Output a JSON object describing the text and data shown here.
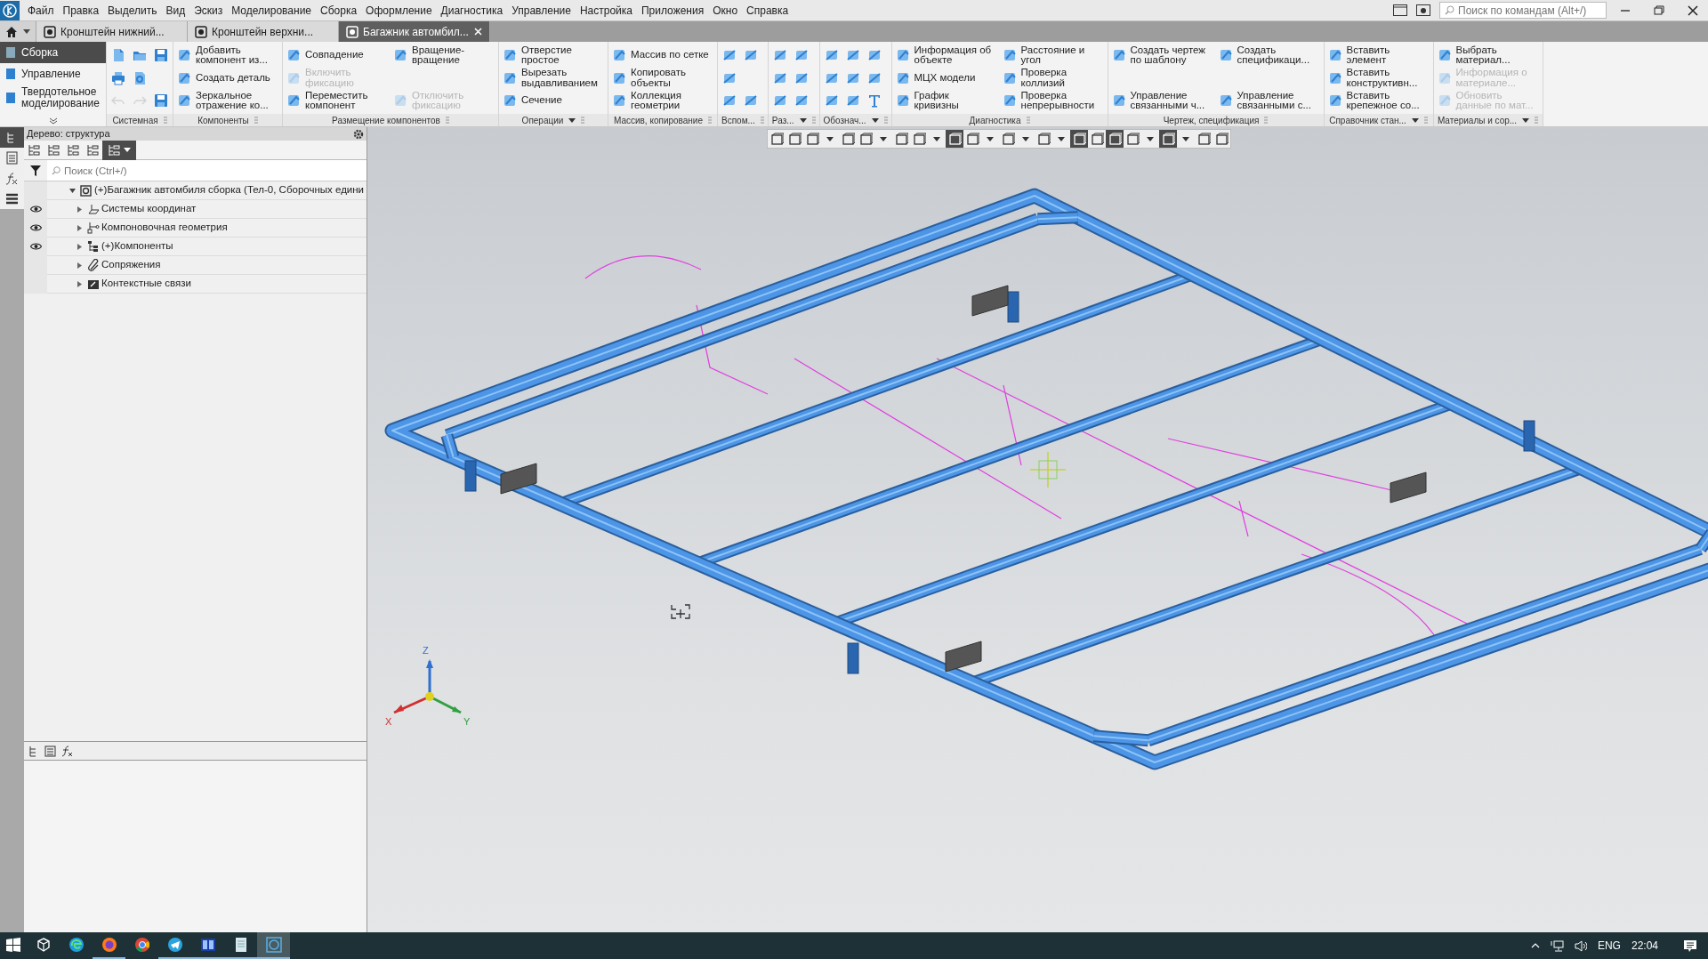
{
  "menu": {
    "items": [
      "Файл",
      "Правка",
      "Выделить",
      "Вид",
      "Эскиз",
      "Моделирование",
      "Сборка",
      "Оформление",
      "Диагностика",
      "Управление",
      "Настройка",
      "Приложения",
      "Окно",
      "Справка"
    ]
  },
  "command_search": {
    "placeholder": "Поиск по командам (Alt+/)"
  },
  "document_tabs": [
    {
      "label": "Кронштейн нижний...",
      "selected": false
    },
    {
      "label": "Кронштейн верхни...",
      "selected": false
    },
    {
      "label": "Багажник автомбил...",
      "selected": true
    }
  ],
  "ribbon": {
    "modes": [
      {
        "label": "Сборка",
        "selected": true
      },
      {
        "label": "Управление",
        "selected": false
      },
      {
        "label": "Твердотельное моделирование",
        "selected": false
      }
    ],
    "groups": [
      {
        "title": "Системная",
        "dropdown": false,
        "columns": [
          [
            {
              "kind": "document",
              "disabled": false
            },
            {
              "kind": "printer",
              "disabled": false
            },
            {
              "kind": "undo",
              "disabled": true
            }
          ],
          [
            {
              "kind": "folder",
              "disabled": false
            },
            {
              "kind": "preview",
              "disabled": false
            },
            {
              "kind": "redo",
              "disabled": true
            }
          ],
          [
            {
              "kind": "disk",
              "disabled": false
            },
            {
              "kind": "disk",
              "disabled": false
            }
          ]
        ]
      },
      {
        "title": "Компоненты",
        "dropdown": false,
        "columns": [
          [
            {
              "kind": "labeled",
              "label": "Добавить компонент из...",
              "disabled": false
            },
            {
              "kind": "labeled",
              "label": "Создать деталь",
              "disabled": false
            },
            {
              "kind": "labeled",
              "label": "Зеркальное отражение ко...",
              "disabled": false
            }
          ]
        ]
      },
      {
        "title": "Размещение компонентов",
        "dropdown": false,
        "columns": [
          [
            {
              "kind": "labeled",
              "label": "Совпадение",
              "disabled": false
            },
            {
              "kind": "labeled",
              "label": "Включить фиксацию",
              "disabled": true
            },
            {
              "kind": "labeled",
              "label": "Переместить компонент",
              "disabled": false
            }
          ],
          [
            {
              "kind": "labeled",
              "label": "Вращение-вращение",
              "disabled": false
            },
            {
              "kind": "labeled",
              "label": "Отключить фиксацию",
              "disabled": true
            }
          ]
        ]
      },
      {
        "title": "Операции",
        "dropdown": true,
        "columns": [
          [
            {
              "kind": "labeled",
              "label": "Отверстие простое",
              "disabled": false
            },
            {
              "kind": "labeled",
              "label": "Вырезать выдавливанием",
              "disabled": false
            },
            {
              "kind": "labeled",
              "label": "Сечение",
              "disabled": false
            }
          ]
        ]
      },
      {
        "title": "Массив, копирование",
        "dropdown": false,
        "columns": [
          [
            {
              "kind": "labeled",
              "label": "Массив по сетке",
              "disabled": false
            },
            {
              "kind": "labeled",
              "label": "Копировать объекты",
              "disabled": false
            },
            {
              "kind": "labeled",
              "label": "Коллекция геометрии",
              "disabled": false
            }
          ]
        ]
      },
      {
        "title": "Вспом...",
        "dropdown": false,
        "columns": [
          [
            {
              "kind": "tool",
              "disabled": false
            },
            {
              "kind": "tool",
              "disabled": false
            },
            {
              "kind": "tool",
              "disabled": false
            }
          ],
          [
            {
              "kind": "tool",
              "disabled": false
            },
            {
              "kind": "tool",
              "disabled": false
            }
          ]
        ]
      },
      {
        "title": "Раз...",
        "dropdown": true,
        "columns": [
          [
            {
              "kind": "tool",
              "disabled": false
            },
            {
              "kind": "tool",
              "disabled": false
            },
            {
              "kind": "tool",
              "disabled": false
            }
          ],
          [
            {
              "kind": "tool",
              "disabled": false
            },
            {
              "kind": "tool",
              "disabled": false
            },
            {
              "kind": "tool",
              "disabled": false
            }
          ]
        ]
      },
      {
        "title": "Обознач...",
        "dropdown": true,
        "columns": [
          [
            {
              "kind": "tool",
              "disabled": false
            },
            {
              "kind": "tool",
              "disabled": false
            },
            {
              "kind": "tool",
              "disabled": false
            }
          ],
          [
            {
              "kind": "tool",
              "disabled": false
            },
            {
              "kind": "tool",
              "disabled": false
            },
            {
              "kind": "tool",
              "disabled": false
            }
          ],
          [
            {
              "kind": "tool",
              "disabled": false
            },
            {
              "kind": "tool",
              "disabled": false
            },
            {
              "kind": "text",
              "disabled": false
            }
          ]
        ]
      },
      {
        "title": "Диагностика",
        "dropdown": false,
        "columns": [
          [
            {
              "kind": "labeled",
              "label": "Информация об объекте",
              "disabled": false
            },
            {
              "kind": "labeled",
              "label": "МЦХ модели",
              "disabled": false
            },
            {
              "kind": "labeled",
              "label": "График кривизны",
              "disabled": false
            }
          ],
          [
            {
              "kind": "labeled",
              "label": "Расстояние и угол",
              "disabled": false
            },
            {
              "kind": "labeled",
              "label": "Проверка коллизий",
              "disabled": false
            },
            {
              "kind": "labeled",
              "label": "Проверка непрерывности",
              "disabled": false
            }
          ]
        ]
      },
      {
        "title": "Чертеж, спецификация",
        "dropdown": false,
        "columns": [
          [
            {
              "kind": "labeled",
              "label": "Создать чертеж по шаблону",
              "disabled": false
            },
            {
              "kind": "labeled",
              "label": "Управление связанными ч...",
              "disabled": false
            }
          ],
          [
            {
              "kind": "labeled",
              "label": "Создать спецификаци...",
              "disabled": false
            },
            {
              "kind": "labeled",
              "label": "Управление связанными с...",
              "disabled": false
            }
          ]
        ]
      },
      {
        "title": "Справочник стан...",
        "dropdown": true,
        "columns": [
          [
            {
              "kind": "labeled",
              "label": "Вставить элемент",
              "disabled": false
            },
            {
              "kind": "labeled",
              "label": "Вставить конструктивн...",
              "disabled": false
            },
            {
              "kind": "labeled",
              "label": "Вставить крепежное со...",
              "disabled": false
            }
          ]
        ]
      },
      {
        "title": "Материалы и сор...",
        "dropdown": true,
        "columns": [
          [
            {
              "kind": "labeled",
              "label": "Выбрать материал...",
              "disabled": false
            },
            {
              "kind": "labeled",
              "label": "Информация о материале...",
              "disabled": true
            },
            {
              "kind": "labeled",
              "label": "Обновить данные по мат...",
              "disabled": true
            }
          ]
        ]
      }
    ]
  },
  "tree_panel": {
    "title": "Дерево: структура",
    "search": {
      "placeholder": "Поиск (Ctrl+/)"
    },
    "root": {
      "label": "(+)Багажник автомбиля сборка (Тел-0, Сборочных едини",
      "expanded": true,
      "children": [
        {
          "label": "Системы координат",
          "visible": true,
          "expanded": false
        },
        {
          "label": "Компоновочная геометрия",
          "visible": true,
          "expanded": false
        },
        {
          "label": "(+)Компоненты",
          "visible": true,
          "expanded": false
        },
        {
          "label": "Сопряжения",
          "visible": false,
          "expanded": false
        },
        {
          "label": "Контекстные связи",
          "visible": false,
          "expanded": false
        }
      ]
    }
  },
  "viewport": {
    "axis_labels": [
      "X",
      "Y",
      "Z"
    ]
  },
  "taskbar": {
    "apps": [
      {
        "kind": "cube",
        "running": false,
        "selected": false
      },
      {
        "kind": "edge",
        "running": false,
        "selected": false
      },
      {
        "kind": "firefox",
        "running": true,
        "selected": false
      },
      {
        "kind": "chrome",
        "running": false,
        "selected": false
      },
      {
        "kind": "telegram",
        "running": true,
        "selected": false
      },
      {
        "kind": "reader",
        "running": true,
        "selected": false
      },
      {
        "kind": "notepad",
        "running": true,
        "selected": false
      },
      {
        "kind": "kompas",
        "running": true,
        "selected": true
      }
    ],
    "language": "ENG",
    "time": "22:04"
  }
}
